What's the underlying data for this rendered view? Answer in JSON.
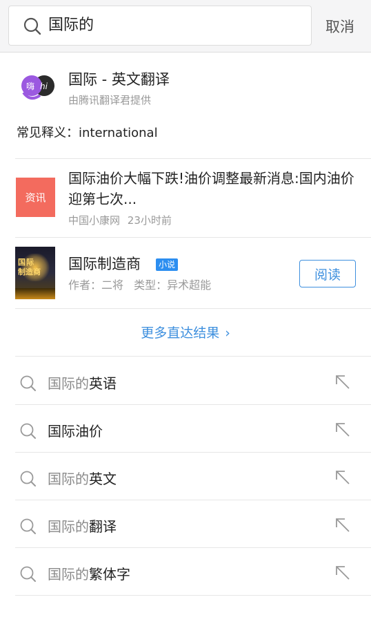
{
  "search": {
    "query": "国际的",
    "cancel_label": "取消"
  },
  "translation": {
    "logo_text": "嗨",
    "logo_sub": "hi",
    "title": "国际 - 英文翻译",
    "provider": "由腾讯翻译君提供",
    "meaning_label": "常见释义：",
    "meaning_value": "international"
  },
  "news": {
    "tag": "资讯",
    "title": "国际油价大幅下跌!油价调整最新消息:国内油价迎第七次...",
    "source": "中国小康网",
    "time": "23小时前"
  },
  "book": {
    "cover_line1": "国际",
    "cover_line2": "制造商",
    "title": "国际制造商",
    "badge": "小说",
    "author_label": "作者：",
    "author": "二将",
    "type_label": "类型：",
    "type": "异术超能",
    "read_label": "阅读"
  },
  "more_results_label": "更多直达结果",
  "suggestions": [
    {
      "prefix": "国际的",
      "suffix": "英语"
    },
    {
      "prefix": "",
      "suffix": "国际油价"
    },
    {
      "prefix": "国际的",
      "suffix": "英文"
    },
    {
      "prefix": "国际的",
      "suffix": "翻译"
    },
    {
      "prefix": "国际的",
      "suffix": "繁体字"
    }
  ],
  "colors": {
    "accent": "#3d8fde",
    "news_tag": "#f36b5e",
    "badge": "#2c8ef0"
  }
}
